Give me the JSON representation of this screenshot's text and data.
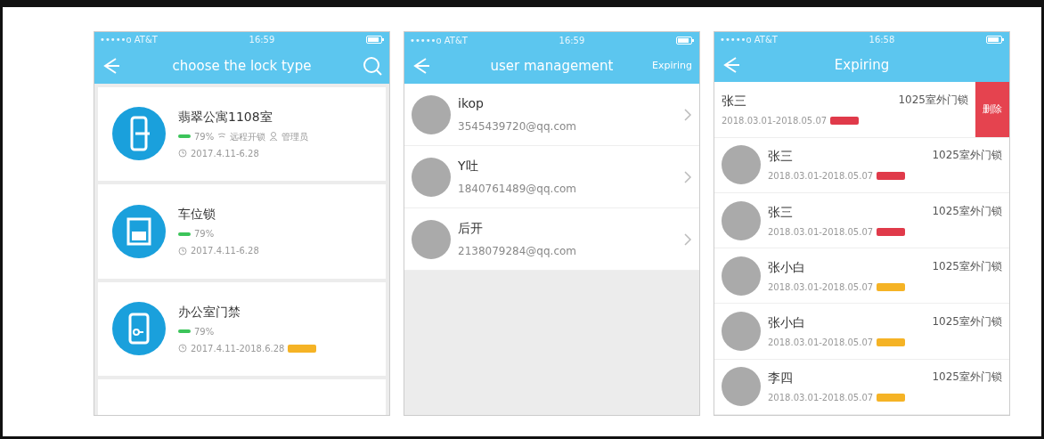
{
  "screens": [
    {
      "kind": "locks",
      "status_bar": {
        "carrier": "•••••o AT&T",
        "time": "16:59"
      },
      "title": "choose the lock type",
      "locks": [
        {
          "kind": "door",
          "name": "翡翠公寓1108室",
          "battery": "79%",
          "features": [
            "远程开锁",
            "管理员"
          ],
          "period": "2017.4.11-6.28"
        },
        {
          "kind": "parking",
          "name": "车位锁",
          "battery": "79%",
          "period": "2017.4.11-6.28"
        },
        {
          "kind": "office",
          "name": "办公室门禁",
          "battery": "79%",
          "period": "2017.4.11-2018.6.28",
          "color": "#f5b325"
        }
      ]
    },
    {
      "kind": "users",
      "status_bar": {
        "carrier": "•••••o AT&T",
        "time": "16:59"
      },
      "title": "user management",
      "action": "Expiring",
      "users": [
        {
          "name": "ikop",
          "email": "3545439720@qq.com"
        },
        {
          "name": "Y吐",
          "email": "1840761489@qq.com"
        },
        {
          "name": "后开",
          "email": "2138079284@qq.com"
        }
      ]
    },
    {
      "kind": "expiring",
      "status_bar": {
        "carrier": "•••••o AT&T",
        "time": "16:58"
      },
      "title": "Expiring",
      "entries": [
        {
          "name": "张三",
          "lock": "1025室外门锁",
          "period": "2018.03.01-2018.05.07",
          "color": "#e03a4a",
          "swiped": true,
          "delete_label": "删除"
        },
        {
          "name": "张三",
          "lock": "1025室外门锁",
          "period": "2018.03.01-2018.05.07",
          "color": "#e03a4a",
          "swiped": false
        },
        {
          "name": "张三",
          "lock": "1025室外门锁",
          "period": "2018.03.01-2018.05.07",
          "color": "#e03a4a",
          "swiped": false
        },
        {
          "name": "张小白",
          "lock": "1025室外门锁",
          "period": "2018.03.01-2018.05.07",
          "color": "#f5b325",
          "swiped": false
        },
        {
          "name": "张小白",
          "lock": "1025室外门锁",
          "period": "2018.03.01-2018.05.07",
          "color": "#f5b325",
          "swiped": false
        },
        {
          "name": "李四",
          "lock": "1025室外门锁",
          "period": "2018.03.01-2018.05.07",
          "color": "#f5b325",
          "swiped": false
        }
      ]
    }
  ]
}
